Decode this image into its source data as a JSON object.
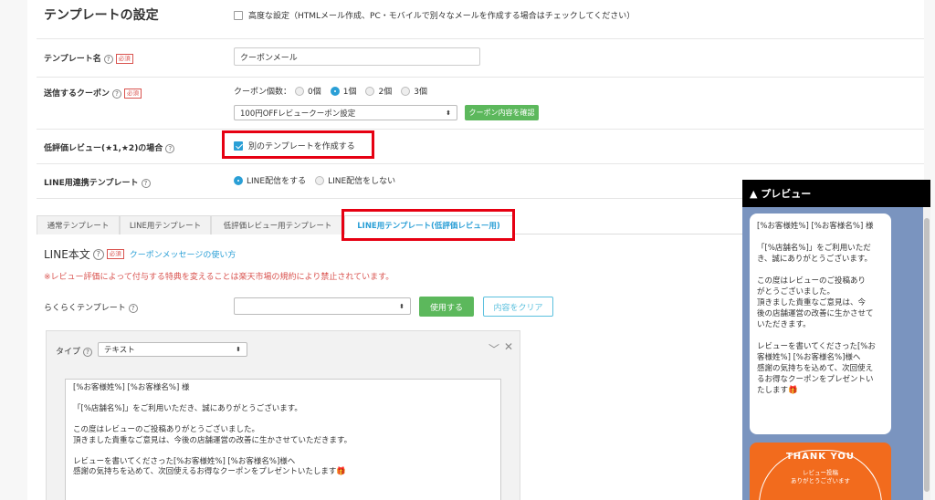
{
  "header": {
    "title": "テンプレートの設定",
    "advanced_label": "高度な設定（HTMLメール作成、PC・モバイルで別々なメールを作成する場合はチェックしてください）"
  },
  "template_name": {
    "label": "テンプレート名",
    "required": "必須",
    "value": "クーポンメール"
  },
  "coupon": {
    "label": "送信するクーポン",
    "required": "必須",
    "count_label": "クーポン個数：",
    "options": [
      "0個",
      "1個",
      "2個",
      "3個"
    ],
    "selected_index": 1,
    "select_value": "100円OFFレビュークーポン設定",
    "confirm_button": "クーポン内容を確認"
  },
  "low_review": {
    "label": "低評価レビュー(★1,★2)の場合",
    "checkbox_label": "別のテンプレートを作成する",
    "checked": true
  },
  "line_link": {
    "label": "LINE用連携テンプレート",
    "options": [
      "LINE配信をする",
      "LINE配信をしない"
    ],
    "selected_index": 0
  },
  "tabs": [
    {
      "label": "通常テンプレート"
    },
    {
      "label": "LINE用テンプレート"
    },
    {
      "label": "低評価レビュー用テンプレート"
    },
    {
      "label": "LINE用テンプレート(低評価レビュー用)",
      "active": true
    }
  ],
  "line_body": {
    "title": "LINE本文",
    "required": "必須",
    "link": "クーポンメッセージの使い方",
    "warning": "※レビュー評価によって付与する特典を変えることは楽天市場の規約により禁止されています。"
  },
  "easy_template": {
    "label": "らくらくテンプレート",
    "select_value": "",
    "use_button": "使用する",
    "clear_button": "内容をクリア"
  },
  "type_panel": {
    "label": "タイプ",
    "select_value": "テキスト",
    "lines": [
      "[%お客様姓%] [%お客様名%] 様",
      "",
      "「[%店舗名%]」をご利用いただき、誠にありがとうございます。",
      "",
      "この度はレビューのご投稿ありがとうございました。",
      "頂きました貴重なご意見は、今後の店舗運営の改善に生かさせていただきます。",
      "",
      "レビューを書いてくださった[%お客様姓%] [%お客様名%]様へ",
      "感謝の気持ちを込めて、次回使えるお得なクーポンをプレゼントいたします🎁"
    ]
  },
  "preview": {
    "title": "▲ プレビュー",
    "lines": [
      "[%お客様姓%] [%お客様名%] 様",
      "",
      "「[%店舗名%]」をご利用いただ",
      "き、誠にありがとうございます。",
      "",
      "この度はレビューのご投稿あり",
      "がとうございました。",
      "頂きました貴重なご意見は、今",
      "後の店舗運営の改善に生かさせて",
      "いただきます。",
      "",
      "レビューを書いてくださった[%お",
      "客様姓%] [%お客様名%]様へ",
      "感謝の気持ちを込めて、次回使え",
      "るお得なクーポンをプレゼントい",
      "たします🎁"
    ],
    "card_title": "THANK YOU",
    "card_line1": "レビュー投稿",
    "card_line2": "ありがとうございます"
  },
  "colors": {
    "accent": "#2a9fd6",
    "green": "#5cb85c",
    "highlight": "#e60012",
    "warning": "#d9534f",
    "preview_bg": "#7a94bf",
    "card": "#f26b1d"
  }
}
